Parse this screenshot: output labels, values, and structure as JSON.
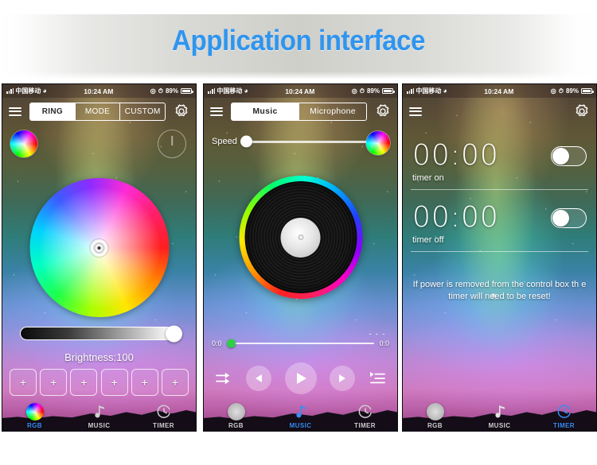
{
  "banner": {
    "title": "Application interface"
  },
  "status_bar": {
    "carrier": "中国移动",
    "wifi_icon": "wifi-icon",
    "time": "10:24 AM",
    "location_icon": "location-icon",
    "alarm_icon": "alarm-icon",
    "battery_percent": "89%"
  },
  "phone1": {
    "menu_icon": "hamburger-menu-icon",
    "gear_icon": "gear-icon",
    "segments": [
      {
        "label": "RING",
        "active": true
      },
      {
        "label": "MODE",
        "active": false
      },
      {
        "label": "CUSTOM",
        "active": false
      }
    ],
    "color_wheel_icon": "color-wheel-icon",
    "power_icon": "power-icon",
    "brightness_label": "Brightness:100",
    "brightness_value": 100,
    "preset_buttons": [
      "+",
      "+",
      "+",
      "+",
      "+",
      "+"
    ]
  },
  "phone2": {
    "menu_icon": "hamburger-menu-icon",
    "gear_icon": "gear-icon",
    "segments": [
      {
        "label": "Music",
        "active": true
      },
      {
        "label": "Microphone",
        "active": false
      }
    ],
    "speed_label": "Speed",
    "speed_value": "0",
    "color_wheel_icon": "color-wheel-icon",
    "disc_icon": "vinyl-record-icon",
    "time_elapsed": "0:0",
    "time_total": "0:0",
    "dots": "- - -",
    "controls": {
      "shuffle_icon": "shuffle-icon",
      "previous_icon": "previous-track-icon",
      "play_icon": "play-icon",
      "next_icon": "next-track-icon",
      "playlist_icon": "playlist-icon"
    }
  },
  "phone3": {
    "menu_icon": "hamburger-menu-icon",
    "gear_icon": "gear-icon",
    "timer_on": {
      "time": "00:00",
      "label": "timer on",
      "enabled": false
    },
    "timer_off": {
      "time": "00:00",
      "label": "timer off",
      "enabled": false
    },
    "warning": "If power is removed from the control box th e timer will need to be reset!"
  },
  "tabs": [
    {
      "label": "RGB",
      "icon": "rgb-color-wheel-icon",
      "active_on_phone": 1
    },
    {
      "label": "MUSIC",
      "icon": "music-note-icon",
      "active_on_phone": 2
    },
    {
      "label": "TIMER",
      "icon": "timer-clock-icon",
      "active_on_phone": 3
    }
  ],
  "colors": {
    "accent_blue": "#3a8cf0",
    "title_blue": "#2f95ef",
    "inactive_grey": "#cfcfcf",
    "progress_green": "#2fcf4a"
  }
}
